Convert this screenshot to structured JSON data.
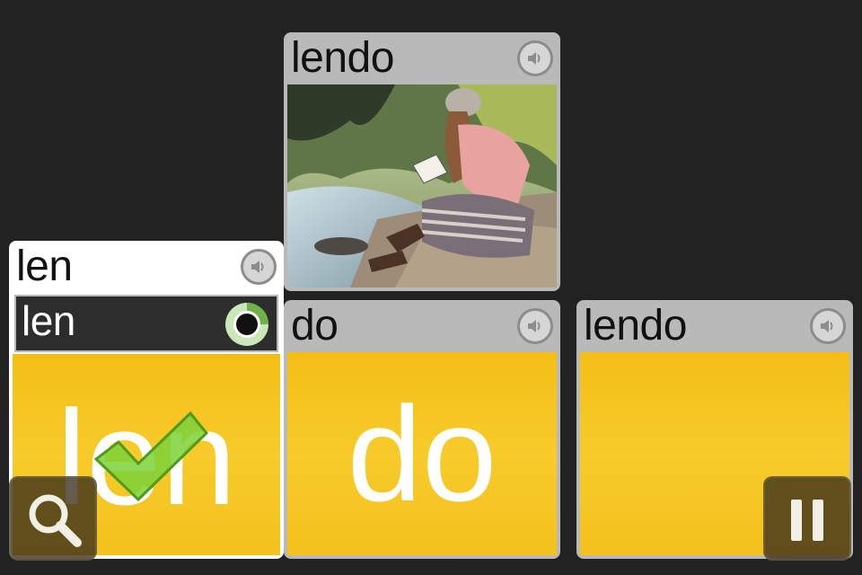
{
  "cards": [
    {
      "id": "top",
      "word": "lendo",
      "image_alt": "person reading"
    },
    {
      "id": "bottom-left",
      "word": "len",
      "record_word": "len",
      "big_text": "len",
      "result": "correct"
    },
    {
      "id": "bottom-middle",
      "word": "do",
      "big_text": "do"
    },
    {
      "id": "bottom-right",
      "word": "lendo"
    }
  ],
  "icons": {
    "speaker": "speaker-icon",
    "record": "record-icon",
    "check": "check-icon",
    "search": "magnifier-icon",
    "pause": "pause-icon"
  },
  "colors": {
    "background": "#222222",
    "card_grey": "#b9b9b9",
    "tile_yellow": "#f6c51d",
    "check_green": "#7bd23a"
  }
}
